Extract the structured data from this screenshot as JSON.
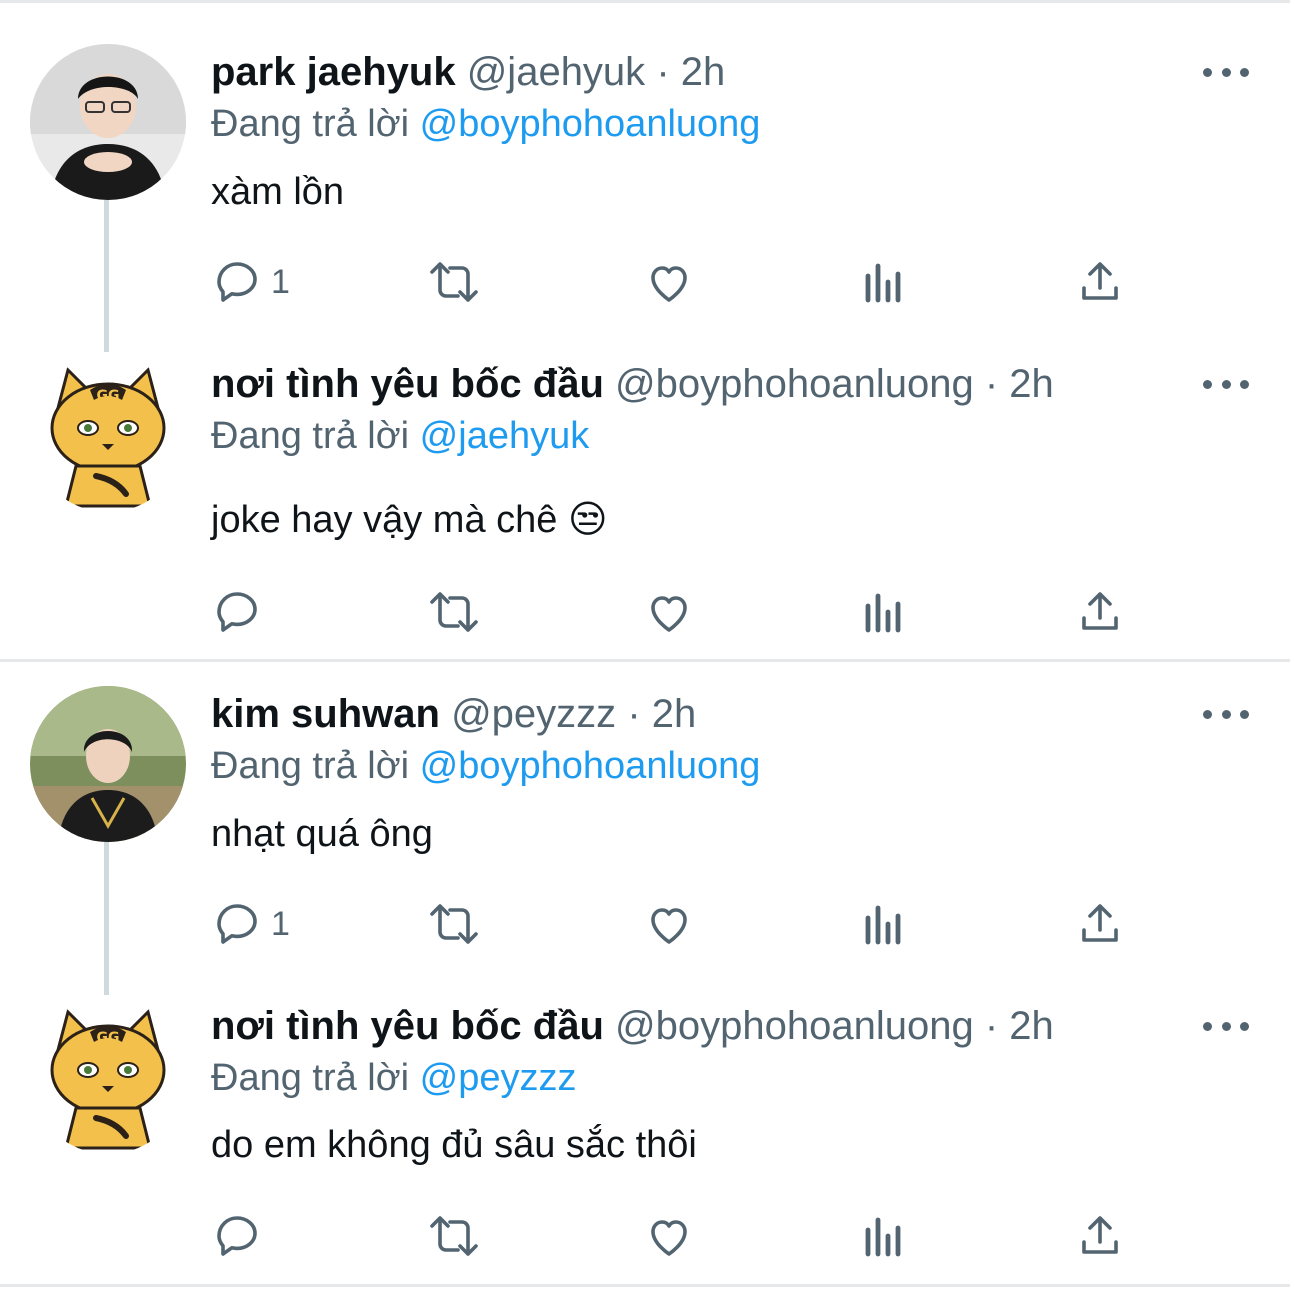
{
  "tweets": [
    {
      "display_name": "park jaehyuk",
      "handle": "@jaehyuk",
      "separator": "·",
      "time": "2h",
      "reply_prefix": "Đang trả lời",
      "reply_to": "@boyphohoanluong",
      "text": "xàm lồn",
      "reply_count": "1",
      "avatar_icon": "person-photo-avatar"
    },
    {
      "display_name": "nơi tình yêu bốc đầu",
      "handle": "@boyphohoanluong",
      "separator": "·",
      "time": "2h",
      "reply_prefix": "Đang trả lời",
      "reply_to": "@jaehyuk",
      "text": "joke hay vậy mà chê 😒",
      "reply_count": "",
      "avatar_icon": "tiger-mascot-avatar"
    },
    {
      "display_name": "kim suhwan",
      "handle": "@peyzzz",
      "separator": "·",
      "time": "2h",
      "reply_prefix": "Đang trả lời",
      "reply_to": "@boyphohoanluong",
      "text": "nhạt quá ông",
      "reply_count": "1",
      "avatar_icon": "person-photo-avatar"
    },
    {
      "display_name": "nơi tình yêu bốc đầu",
      "handle": "@boyphohoanluong",
      "separator": "·",
      "time": "2h",
      "reply_prefix": "Đang trả lời",
      "reply_to": "@peyzzz",
      "text": "do em không đủ sâu sắc thôi",
      "reply_count": "",
      "avatar_icon": "tiger-mascot-avatar"
    }
  ],
  "icons": {
    "reply": "reply-icon",
    "retweet": "retweet-icon",
    "like": "heart-icon",
    "views": "views-chart-icon",
    "share": "share-icon",
    "more": "more-dots-icon"
  },
  "colors": {
    "text": "#0f1419",
    "secondary": "#536471",
    "link": "#1d9bf0",
    "divider": "#e6e8ea",
    "thread_line": "#cfd9de",
    "mascot_gold": "#f3c14b"
  }
}
